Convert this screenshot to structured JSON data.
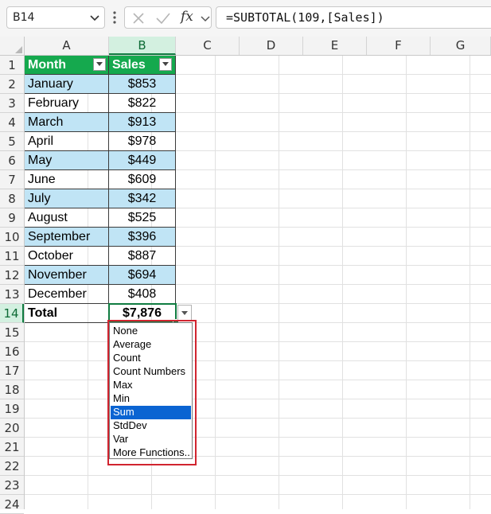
{
  "formula_bar": {
    "name_box": "B14",
    "fx_label": "fx",
    "formula": "=SUBTOTAL(109,[Sales])"
  },
  "columns": [
    "A",
    "B",
    "C",
    "D",
    "E",
    "F",
    "G"
  ],
  "rows": [
    "1",
    "2",
    "3",
    "4",
    "5",
    "6",
    "7",
    "8",
    "9",
    "10",
    "11",
    "12",
    "13",
    "14",
    "15",
    "16",
    "17",
    "18",
    "19",
    "20",
    "21",
    "22",
    "23",
    "24"
  ],
  "table": {
    "headers": {
      "month": "Month",
      "sales": "Sales"
    },
    "data": [
      {
        "month": "January",
        "sales": "$853"
      },
      {
        "month": "February",
        "sales": "$822"
      },
      {
        "month": "March",
        "sales": "$913"
      },
      {
        "month": "April",
        "sales": "$978"
      },
      {
        "month": "May",
        "sales": "$449"
      },
      {
        "month": "June",
        "sales": "$609"
      },
      {
        "month": "July",
        "sales": "$342"
      },
      {
        "month": "August",
        "sales": "$525"
      },
      {
        "month": "September",
        "sales": "$396"
      },
      {
        "month": "October",
        "sales": "$887"
      },
      {
        "month": "November",
        "sales": "$694"
      },
      {
        "month": "December",
        "sales": "$408"
      }
    ],
    "total_label": "Total",
    "total_value": "$7,876"
  },
  "dropdown": {
    "options": [
      "None",
      "Average",
      "Count",
      "Count Numbers",
      "Max",
      "Min",
      "Sum",
      "StdDev",
      "Var",
      "More Functions..."
    ],
    "selected": "Sum"
  },
  "colors": {
    "header_green": "#15a94e",
    "band_blue": "#c0e4f5",
    "selection_green": "#107c41",
    "highlight_red": "#d1242f",
    "list_selected": "#0a64d2"
  }
}
